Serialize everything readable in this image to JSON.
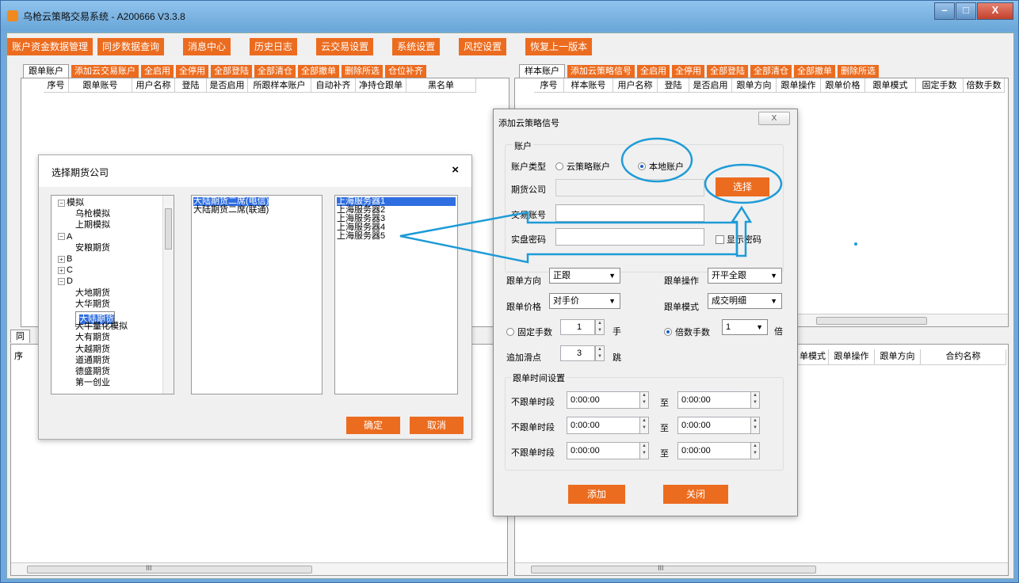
{
  "window": {
    "title": "乌枪云策略交易系统 - A200666 V3.3.8",
    "min": "–",
    "max": "□",
    "close": "X"
  },
  "menu": [
    "账户资金数据管理",
    "同步数据查询",
    "消息中心",
    "历史日志",
    "云交易设置",
    "系统设置",
    "风控设置",
    "恢复上一版本"
  ],
  "left_pane": {
    "tab": "跟单账户",
    "buttons": [
      "添加云交易账户",
      "全启用",
      "全停用",
      "全部登陆",
      "全部清仓",
      "全部撤单",
      "删除所选",
      "仓位补齐"
    ],
    "columns": [
      "序号",
      "跟单账号",
      "用户名称",
      "登陆",
      "是否启用",
      "所跟样本账户",
      "自动补齐",
      "净持仓跟单",
      "黑名单"
    ]
  },
  "right_pane": {
    "tab": "样本账户",
    "buttons": [
      "添加云策略信号",
      "全启用",
      "全停用",
      "全部登陆",
      "全部清仓",
      "全部撤单",
      "删除所选"
    ],
    "columns": [
      "序号",
      "样本账号",
      "用户名称",
      "登陆",
      "是否启用",
      "跟单方向",
      "跟单操作",
      "跟单价格",
      "跟单模式",
      "固定手数",
      "倍数手数"
    ]
  },
  "bottom_left": {
    "tab": "同",
    "col": "序"
  },
  "bottom_right": {
    "columns": [
      "单模式",
      "跟单操作",
      "跟单方向",
      "合约名称"
    ]
  },
  "scroll": {
    "dots": "III"
  },
  "futures_dialog": {
    "title": "选择期货公司",
    "close": "×",
    "tree": [
      {
        "t": "模拟",
        "pm": "−",
        "lvl": 0
      },
      {
        "t": "乌枪模拟",
        "lvl": 1
      },
      {
        "t": "上期模拟",
        "lvl": 1
      },
      {
        "t": "A",
        "pm": "−",
        "lvl": 0
      },
      {
        "t": "安粮期货",
        "lvl": 1
      },
      {
        "t": "B",
        "pm": "+",
        "lvl": 0
      },
      {
        "t": "C",
        "pm": "+",
        "lvl": 0
      },
      {
        "t": "D",
        "pm": "−",
        "lvl": 0
      },
      {
        "t": "大地期货",
        "lvl": 1
      },
      {
        "t": "大华期货",
        "lvl": 1
      },
      {
        "t": "大陆期货",
        "lvl": 1,
        "sel": true
      },
      {
        "t": "大牛量化模拟",
        "lvl": 1
      },
      {
        "t": "大有期货",
        "lvl": 1
      },
      {
        "t": "大越期货",
        "lvl": 1
      },
      {
        "t": "道通期货",
        "lvl": 1
      },
      {
        "t": "德盛期货",
        "lvl": 1
      },
      {
        "t": "第一创业",
        "lvl": 1
      }
    ],
    "seats": [
      "大陆期货二席(电信)",
      "大陆期货二席(联通)"
    ],
    "servers": [
      "上海服务器1",
      "上海服务器2",
      "上海服务器3",
      "上海服务器4",
      "上海服务器5"
    ],
    "ok": "确定",
    "cancel": "取消"
  },
  "cloud_dialog": {
    "title": "添加云策略信号",
    "close": "X",
    "account_group": "账户",
    "account_type_label": "账户类型",
    "type_cloud": "云策略账户",
    "type_local": "本地账户",
    "broker_label": "期货公司",
    "choose": "选择",
    "trade_account_label": "交易账号",
    "password_label": "实盘密码",
    "show_password": "显示密码",
    "direction_label": "跟单方向",
    "direction_value": "正跟",
    "operation_label": "跟单操作",
    "operation_value": "开平全跟",
    "price_label": "跟单价格",
    "price_value": "对手价",
    "mode_label": "跟单模式",
    "mode_value": "成交明细",
    "fixed_label": "固定手数",
    "fixed_value": "1",
    "fixed_unit": "手",
    "multi_label": "倍数手数",
    "multi_value": "1",
    "multi_unit": "倍",
    "slip_label": "追加滑点",
    "slip_value": "3",
    "slip_unit": "跳",
    "time_group": "跟单时间设置",
    "no_follow_label": "不跟单时段",
    "time_value": "0:00:00",
    "to": "至",
    "add": "添加",
    "close_btn": "关闭"
  },
  "colors": {
    "accent": "#ec6c1f",
    "annotation": "#1e9bd7",
    "selection": "#2f6ee0"
  }
}
